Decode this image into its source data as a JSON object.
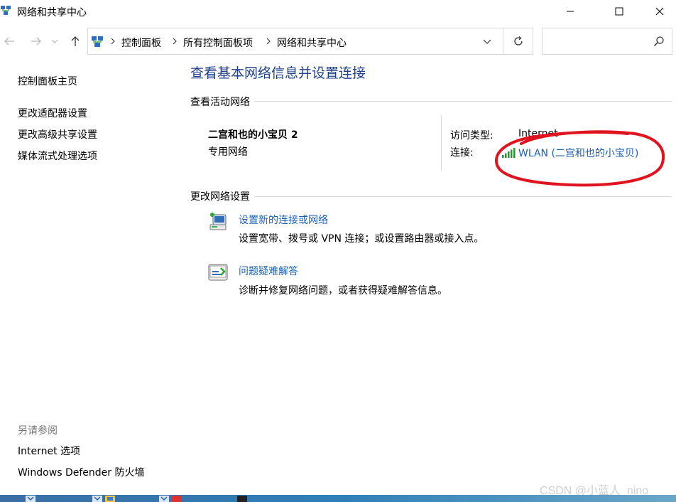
{
  "window": {
    "title": "网络和共享中心"
  },
  "address": {
    "breadcrumbs": [
      "控制面板",
      "所有控制面板项",
      "网络和共享中心"
    ],
    "search_placeholder": ""
  },
  "left_pane": {
    "home": "控制面板主页",
    "links": [
      "更改适配器设置",
      "更改高级共享设置",
      "媒体流式处理选项"
    ],
    "see_also_heading": "另请参阅",
    "see_also": [
      "Internet 选项",
      "Windows Defender 防火墙"
    ]
  },
  "main": {
    "title": "查看基本网络信息并设置连接",
    "active_heading": "查看活动网络",
    "network_name": "二宫和也的小宝贝 2",
    "network_type": "专用网络",
    "access_type_label": "访问类型:",
    "access_type_value": "Internet",
    "connection_label": "连接:",
    "connection_value": "WLAN (二宫和也的小宝贝)",
    "change_heading": "更改网络设置",
    "tasks": [
      {
        "link": "设置新的连接或网络",
        "desc": "设置宽带、拨号或 VPN 连接；或设置路由器或接入点。",
        "icon": "new-connection-icon"
      },
      {
        "link": "问题疑难解答",
        "desc": "诊断并修复网络问题，或者获得疑难解答信息。",
        "icon": "troubleshoot-icon"
      }
    ]
  },
  "watermark": "CSDN @小蓝人_nino",
  "colors": {
    "link": "#1a5fb4",
    "title": "#1e3f8a",
    "annotation": "#e0141e"
  }
}
